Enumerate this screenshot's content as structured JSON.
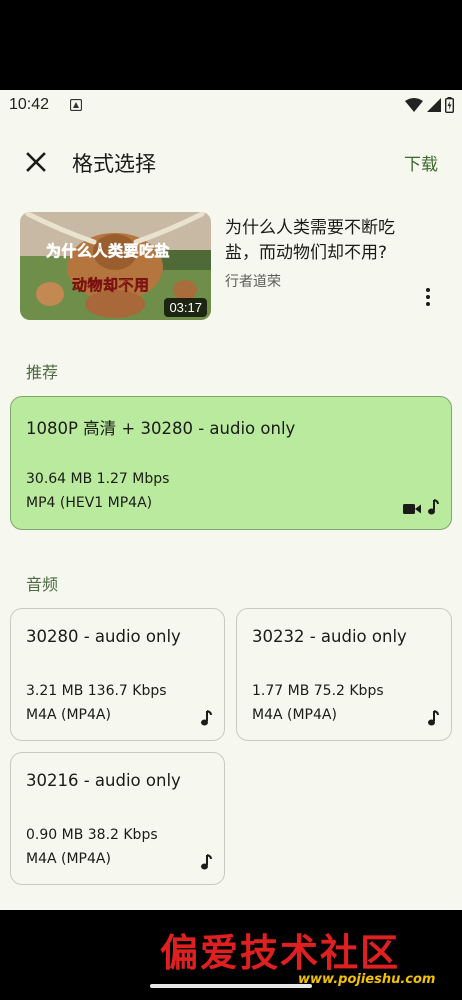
{
  "status": {
    "time": "10:42"
  },
  "appbar": {
    "title": "格式选择",
    "action": "下载"
  },
  "video": {
    "title": "为什么人类需要不断吃盐，而动物们却不用?",
    "author": "行者道荣",
    "duration": "03:17",
    "thumb_caption_1": "为什么人类要吃盐",
    "thumb_caption_2": "动物却不用"
  },
  "sections": {
    "recommended": "推荐",
    "audio": "音频"
  },
  "recommended": {
    "title": "1080P 高清 + 30280 - audio only",
    "size_bitrate": "30.64 MB 1.27 Mbps",
    "codec": "MP4 (HEV1 MP4A)"
  },
  "audio_formats": [
    {
      "title": "30280 - audio only",
      "size_bitrate": "3.21 MB 136.7 Kbps",
      "codec": "M4A (MP4A)"
    },
    {
      "title": "30232 - audio only",
      "size_bitrate": "1.77 MB 75.2 Kbps",
      "codec": "M4A (MP4A)"
    },
    {
      "title": "30216 - audio only",
      "size_bitrate": "0.90 MB 38.2 Kbps",
      "codec": "M4A (MP4A)"
    }
  ],
  "watermark": {
    "text": "偏爱技术社区",
    "url": "www.pojieshu.com"
  },
  "colors": {
    "background": "#f6f7ef",
    "selected_card": "#b9ea9e",
    "accent": "#3c6a2a"
  }
}
